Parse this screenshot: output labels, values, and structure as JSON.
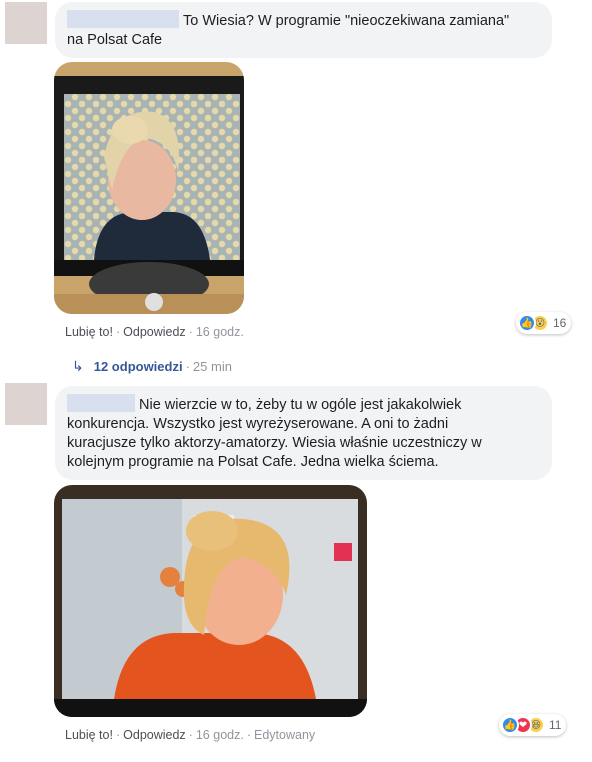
{
  "comments": [
    {
      "text_line1": "To Wiesia? W programie \"nieoczekiwana zamiana\"",
      "text_line2": "na Polsat Cafe",
      "like_label": "Lubię to!",
      "reply_label": "Odpowiedz",
      "time": "16 godz.",
      "reaction_icons": [
        "like-icon",
        "wow-icon"
      ],
      "reaction_count": "16",
      "replies_label": "12 odpowiedzi",
      "replies_time": "25 min"
    },
    {
      "text_line1": "Nie wierzcie w to, żeby tu w ogóle jest jakakolwiek",
      "text_line2": "konkurencja. Wszystko jest wyreżyserowane. A oni to żadni",
      "text_line3": "kuracjusze tylko aktorzy-amatorzy. Wiesia właśnie uczestniczy w",
      "text_line4": "kolejnym programie na Polsat Cafe. Jedna wielka ściema.",
      "like_label": "Lubię to!",
      "reply_label": "Odpowiedz",
      "time": "16 godz.",
      "edited_label": "Edytowany",
      "reaction_icons": [
        "like-icon",
        "love-icon",
        "haha-icon"
      ],
      "reaction_count": "11"
    }
  ],
  "colors": {
    "bubble": "#f2f3f5",
    "link": "#365899",
    "meta": "#90949c",
    "like_blue": "#2e8bf0"
  }
}
